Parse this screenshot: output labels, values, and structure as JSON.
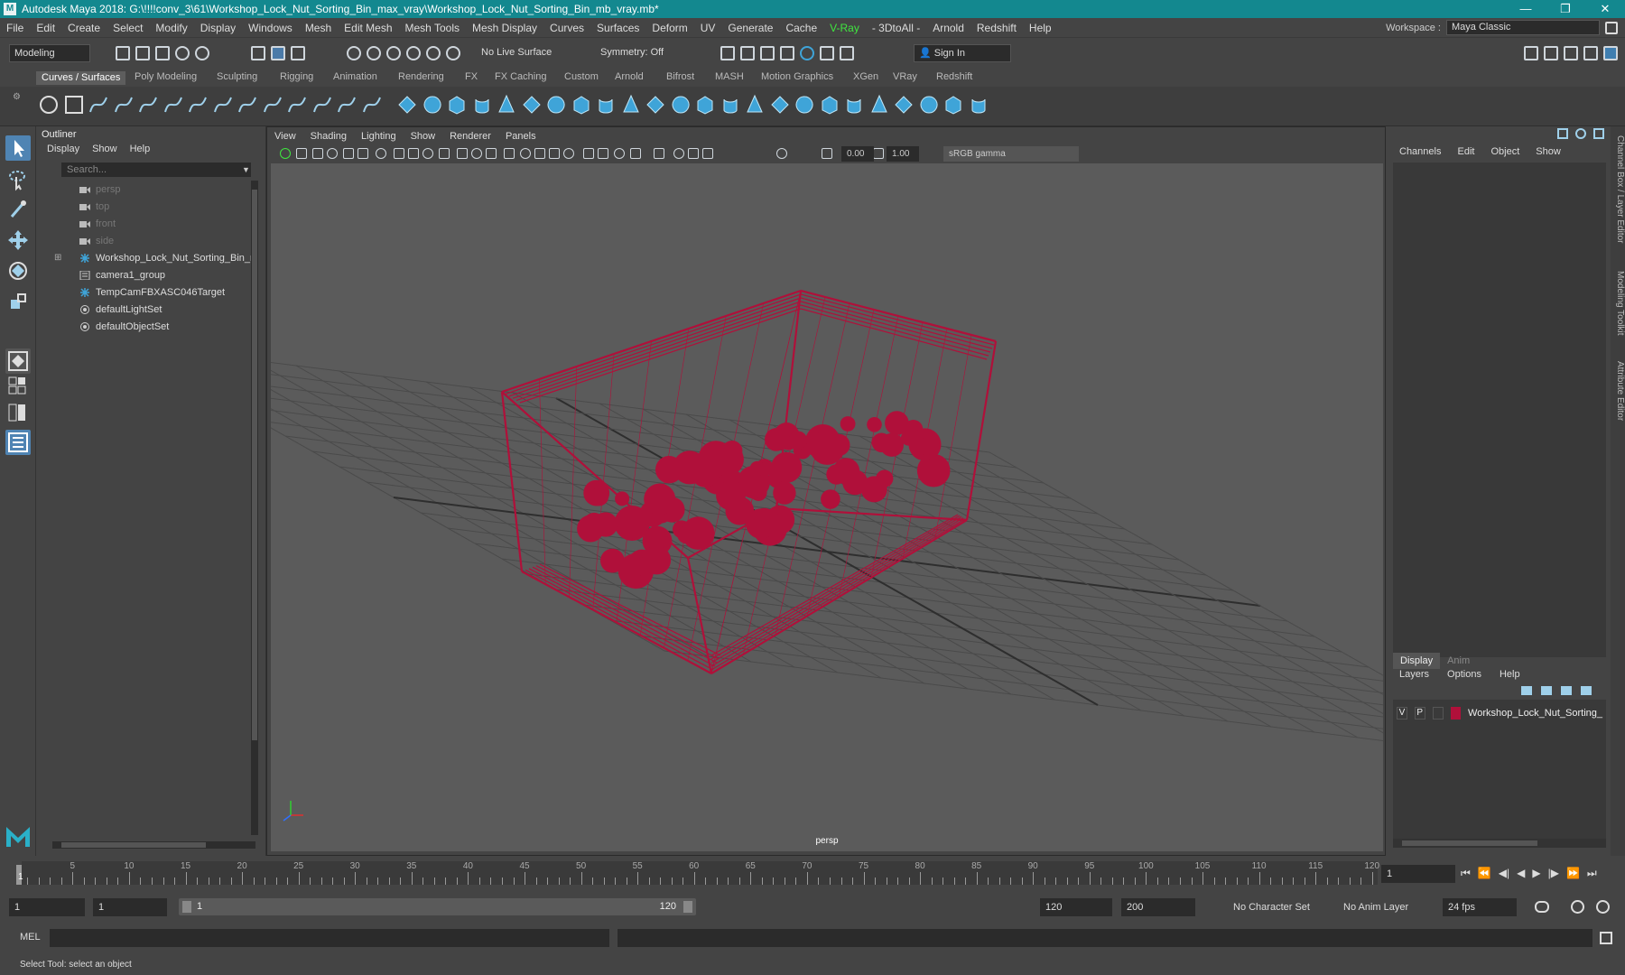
{
  "window": {
    "title": "Autodesk Maya 2018: G:\\!!!!conv_3\\61\\Workshop_Lock_Nut_Sorting_Bin_max_vray\\Workshop_Lock_Nut_Sorting_Bin_mb_vray.mb*",
    "logo": "M"
  },
  "menubar": [
    "File",
    "Edit",
    "Create",
    "Select",
    "Modify",
    "Display",
    "Windows",
    "Mesh",
    "Edit Mesh",
    "Mesh Tools",
    "Mesh Display",
    "Curves",
    "Surfaces",
    "Deform",
    "UV",
    "Generate",
    "Cache",
    "V-Ray",
    "- 3DtoAll -",
    "Arnold",
    "Redshift",
    "Help"
  ],
  "workspace": {
    "label": "Workspace :",
    "value": "Maya Classic"
  },
  "status": {
    "mode": "Modeling",
    "live_surface": "No Live Surface",
    "symmetry": "Symmetry: Off",
    "sign_in": "Sign In"
  },
  "shelf_tabs": [
    "Curves / Surfaces",
    "Poly Modeling",
    "Sculpting",
    "Rigging",
    "Animation",
    "Rendering",
    "FX",
    "FX Caching",
    "Custom",
    "Arnold",
    "Bifrost",
    "MASH",
    "Motion Graphics",
    "XGen",
    "VRay",
    "Redshift"
  ],
  "outliner": {
    "title": "Outliner",
    "menu": [
      "Display",
      "Show",
      "Help"
    ],
    "search_placeholder": "Search...",
    "items": [
      {
        "label": "persp",
        "dim": true,
        "icon": "camera-icon"
      },
      {
        "label": "top",
        "dim": true,
        "icon": "camera-icon"
      },
      {
        "label": "front",
        "dim": true,
        "icon": "camera-icon"
      },
      {
        "label": "side",
        "dim": true,
        "icon": "camera-icon"
      },
      {
        "label": "Workshop_Lock_Nut_Sorting_Bin_ncl",
        "dim": false,
        "icon": "locator-icon",
        "expand": true
      },
      {
        "label": "camera1_group",
        "dim": false,
        "icon": "group-icon"
      },
      {
        "label": "TempCamFBXASC046Target",
        "dim": false,
        "icon": "locator-icon"
      },
      {
        "label": "defaultLightSet",
        "dim": false,
        "icon": "set-icon"
      },
      {
        "label": "defaultObjectSet",
        "dim": false,
        "icon": "set-icon"
      }
    ]
  },
  "viewport": {
    "menu": [
      "View",
      "Shading",
      "Lighting",
      "Show",
      "Renderer",
      "Panels"
    ],
    "exposure": "0.00",
    "gamma": "1.00",
    "color_space": "sRGB gamma",
    "camera": "persp",
    "wire_color": "#b0103a"
  },
  "channels": {
    "menu": [
      "Channels",
      "Edit",
      "Object",
      "Show"
    ]
  },
  "layers": {
    "tabs": [
      "Display",
      "Anim"
    ],
    "menu": [
      "Layers",
      "Options",
      "Help"
    ],
    "row": {
      "v": "V",
      "p": "P",
      "name": "Workshop_Lock_Nut_Sorting_",
      "color": "#b0103a"
    }
  },
  "side_tabs": [
    "Channel Box / Layer Editor",
    "Modeling Toolkit",
    "Attribute Editor"
  ],
  "timeline": {
    "labels": [
      "5",
      "10",
      "15",
      "20",
      "25",
      "30",
      "35",
      "40",
      "45",
      "50",
      "55",
      "60",
      "65",
      "70",
      "75",
      "80",
      "85",
      "90",
      "95",
      "100",
      "105",
      "110",
      "115",
      "120"
    ],
    "current_frame": "1",
    "current_marker": "1"
  },
  "range": {
    "start": "1",
    "playback_start": "1",
    "bar_start": "1",
    "bar_end": "120",
    "playback_end": "120",
    "end": "200",
    "character_set": "No Character Set",
    "anim_layer": "No Anim Layer",
    "fps": "24 fps"
  },
  "mel": {
    "label": "MEL"
  },
  "help_line": "Select Tool: select an object"
}
